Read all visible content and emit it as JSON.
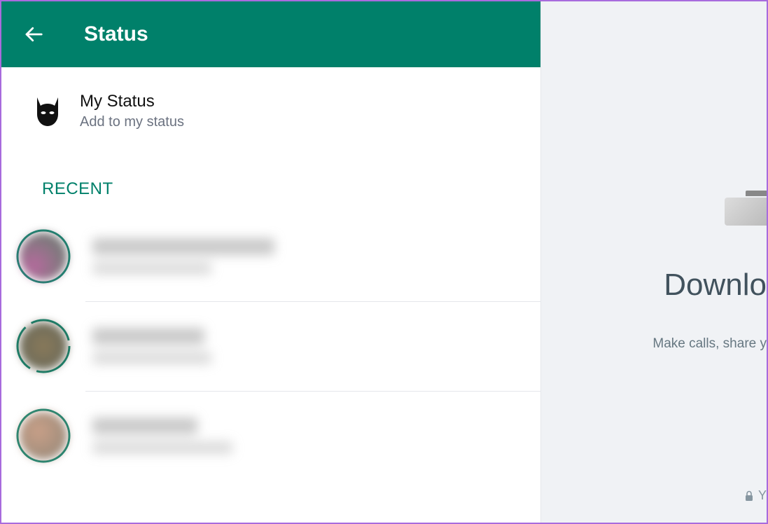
{
  "header": {
    "title": "Status"
  },
  "myStatus": {
    "title": "My Status",
    "subtitle": "Add to my status"
  },
  "sections": {
    "recent": "RECENT"
  },
  "recentStatuses": [
    {
      "avatarClass": "av1",
      "ringType": "solid"
    },
    {
      "avatarClass": "av2",
      "ringType": "segmented"
    },
    {
      "avatarClass": "av3",
      "ringType": "solid"
    }
  ],
  "promo": {
    "title": "Downlo",
    "subtitle": "Make calls, share y",
    "encrypted": "Y"
  },
  "colors": {
    "brand": "#00806a",
    "border": "#a86bdd"
  }
}
